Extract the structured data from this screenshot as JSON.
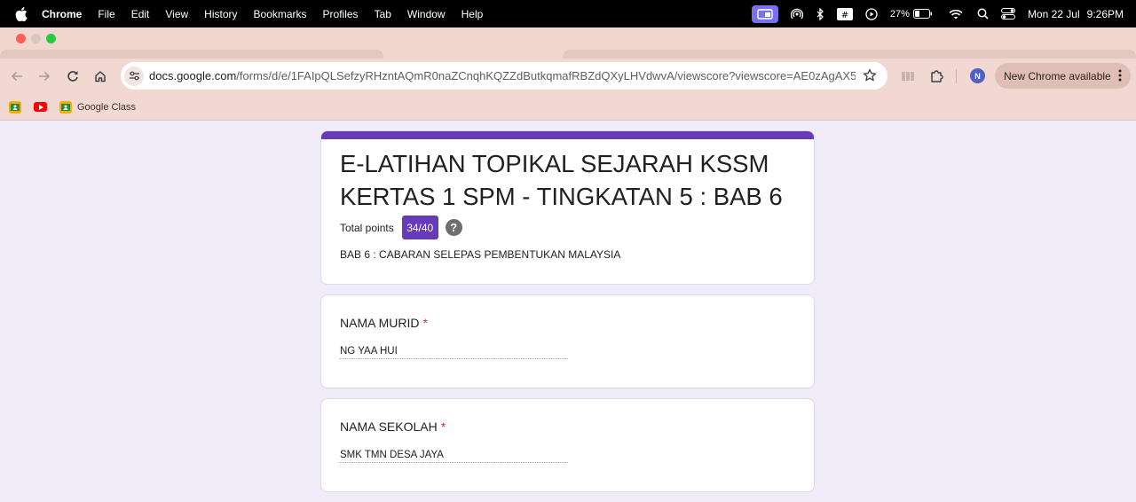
{
  "menubar": {
    "app_name": "Chrome",
    "menus": [
      "File",
      "Edit",
      "View",
      "History",
      "Bookmarks",
      "Profiles",
      "Tab",
      "Window",
      "Help"
    ],
    "battery": "27%",
    "date": "Mon 22 Jul",
    "time": "9:26PM"
  },
  "browser": {
    "url_host": "docs.google.com",
    "url_path": "/forms/d/e/1FAIpQLSefzyRHzntAQmR0naZCnqhKQZZdButkqmafRBZdQXyLHVdwvA/viewscore?viewscore=AE0zAgAX5p...",
    "profile_initial": "N",
    "update_label": "New Chrome available",
    "bookmarks": [
      {
        "label": "",
        "icon": "classroom-icon",
        "color": "#f9ab00"
      },
      {
        "label": "",
        "icon": "youtube-icon",
        "color": "#ff0000"
      },
      {
        "label": "Google Class",
        "icon": "classroom-icon",
        "color": "#f9ab00"
      }
    ]
  },
  "form": {
    "title": "E-LATIHAN TOPIKAL SEJARAH KSSM KERTAS 1 SPM - TINGKATAN 5 : BAB 6",
    "total_points_label": "Total points",
    "score": "34/40",
    "description": "BAB 6 : CABARAN SELEPAS PEMBENTUKAN MALAYSIA",
    "accent": "#673ab7",
    "questions": [
      {
        "title": "NAMA MURID",
        "required_mark": "*",
        "answer": "NG YAA HUI"
      },
      {
        "title": "NAMA SEKOLAH",
        "required_mark": "*",
        "answer": "SMK TMN DESA JAYA"
      }
    ]
  }
}
